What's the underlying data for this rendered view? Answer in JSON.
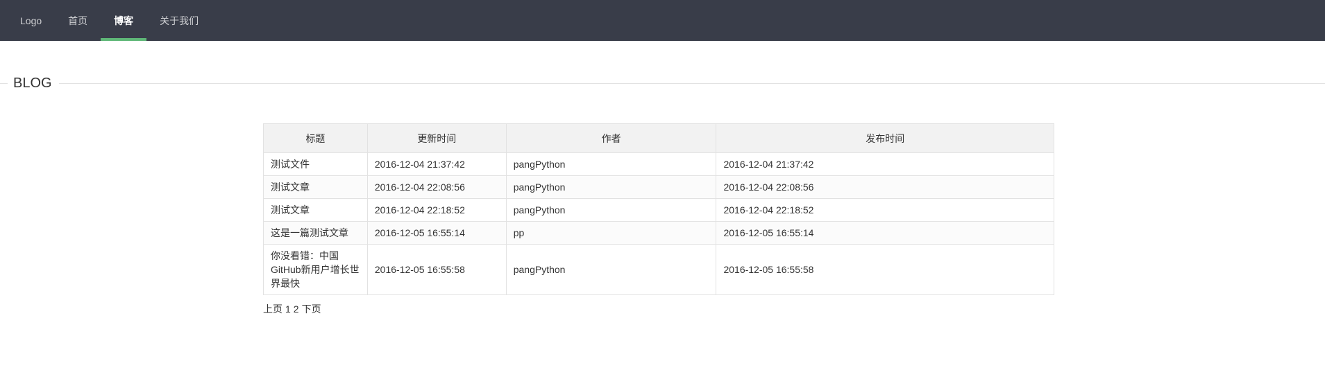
{
  "nav": {
    "items": [
      {
        "label": "Logo",
        "active": false
      },
      {
        "label": "首页",
        "active": false
      },
      {
        "label": "博客",
        "active": true
      },
      {
        "label": "关于我们",
        "active": false
      }
    ],
    "accent_color": "#5fb878",
    "background_color": "#393d49"
  },
  "section": {
    "title": "BLOG"
  },
  "table": {
    "headers": [
      "标题",
      "更新时间",
      "作者",
      "发布时间"
    ],
    "rows": [
      [
        "测试文件",
        "2016-12-04 21:37:42",
        "pangPython",
        "2016-12-04 21:37:42"
      ],
      [
        "测试文章",
        "2016-12-04 22:08:56",
        "pangPython",
        "2016-12-04 22:08:56"
      ],
      [
        "测试文章",
        "2016-12-04 22:18:52",
        "pangPython",
        "2016-12-04 22:18:52"
      ],
      [
        "这是一篇测试文章",
        "2016-12-05 16:55:14",
        "pp",
        "2016-12-05 16:55:14"
      ],
      [
        "你没看错：中国GitHub新用户增长世界最快",
        "2016-12-05 16:55:58",
        "pangPython",
        "2016-12-05 16:55:58"
      ]
    ]
  },
  "pager": {
    "prev": "上页",
    "pages": [
      "1",
      "2"
    ],
    "next": "下页"
  }
}
